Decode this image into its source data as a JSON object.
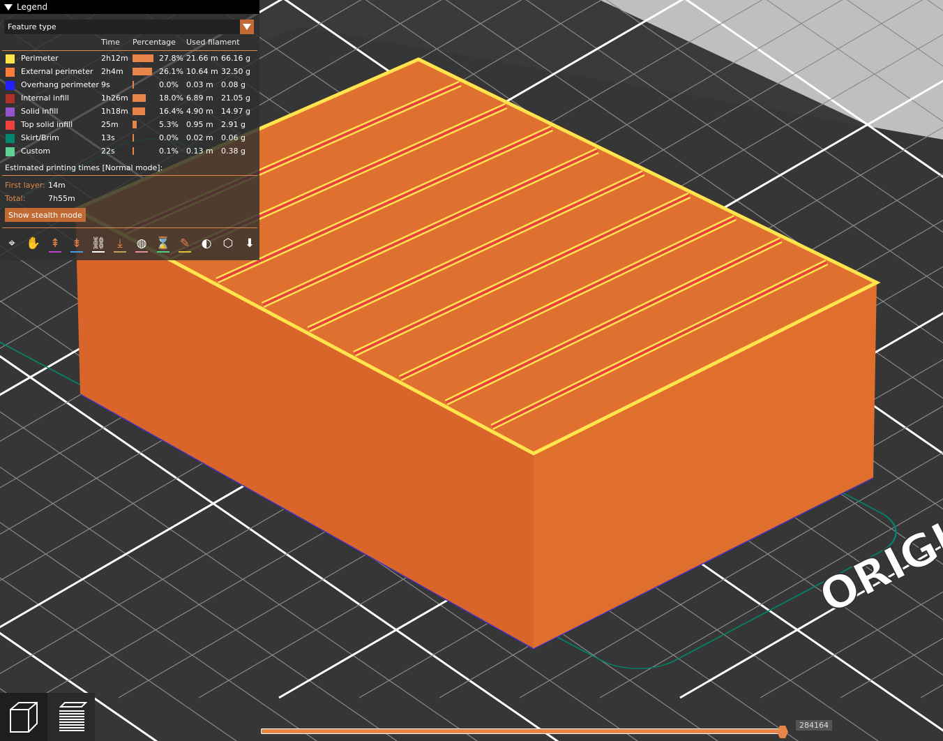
{
  "legend": {
    "title": "Legend",
    "view_type": "Feature type",
    "columns": {
      "time": "Time",
      "percentage": "Percentage",
      "used_filament": "Used filament"
    },
    "rows": [
      {
        "name": "Perimeter",
        "color": "#ffe44d",
        "time": "2h12m",
        "percent": "27.8%",
        "pct": 27.8,
        "length": "21.66 m",
        "weight": "66.16 g"
      },
      {
        "name": "External perimeter",
        "color": "#ff7d38",
        "time": "2h4m",
        "percent": "26.1%",
        "pct": 26.1,
        "length": "10.64 m",
        "weight": "32.50 g"
      },
      {
        "name": "Overhang perimeter",
        "color": "#1f1fff",
        "time": "9s",
        "percent": "0.0%",
        "pct": 0,
        "length": "0.03 m",
        "weight": "0.08 g"
      },
      {
        "name": "Internal infill",
        "color": "#b03029",
        "time": "1h26m",
        "percent": "18.0%",
        "pct": 18.0,
        "length": "6.89 m",
        "weight": "21.05 g"
      },
      {
        "name": "Solid infill",
        "color": "#9654cc",
        "time": "1h18m",
        "percent": "16.4%",
        "pct": 16.4,
        "length": "4.90 m",
        "weight": "14.97 g"
      },
      {
        "name": "Top solid infill",
        "color": "#f04040",
        "time": "25m",
        "percent": "5.3%",
        "pct": 5.3,
        "length": "0.95 m",
        "weight": "2.91 g"
      },
      {
        "name": "Skirt/Brim",
        "color": "#00876e",
        "time": "13s",
        "percent": "0.0%",
        "pct": 0,
        "length": "0.02 m",
        "weight": "0.06 g"
      },
      {
        "name": "Custom",
        "color": "#5ed194",
        "time": "22s",
        "percent": "0.1%",
        "pct": 0.1,
        "length": "0.13 m",
        "weight": "0.38 g"
      }
    ],
    "estimated_title": "Estimated printing times [Normal mode]:",
    "first_layer_label": "First layer:",
    "first_layer": "14m",
    "total_label": "Total:",
    "total": "7h55m",
    "stealth_button": "Show stealth mode"
  },
  "toolbar_icons": [
    "travel-icon",
    "wipe-icon",
    "retractions-icon",
    "deretractions-icon",
    "seams-icon",
    "tool-changes-icon",
    "color-changes-icon",
    "pause-prints-icon",
    "custom-gcode-icon",
    "center-of-gravity-icon",
    "shells-icon",
    "tool-marker-icon"
  ],
  "bed_label": "ORIGIN",
  "slider": {
    "value": "284164",
    "fraction": 1.0
  },
  "accent": "#e8834a"
}
